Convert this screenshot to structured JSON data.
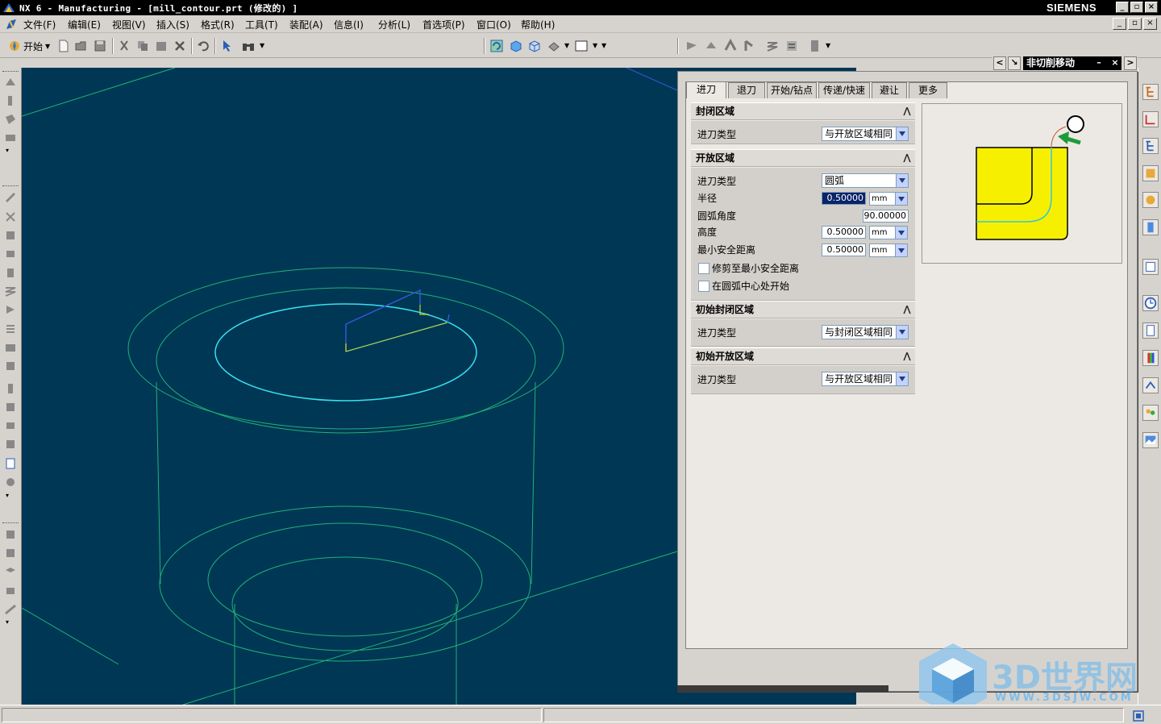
{
  "window": {
    "title": "NX 6 - Manufacturing - [mill_contour.prt  (修改的) ]",
    "brand": "SIEMENS"
  },
  "menu": {
    "items": [
      "文件(F)",
      "编辑(E)",
      "视图(V)",
      "插入(S)",
      "格式(R)",
      "工具(T)",
      "装配(A)",
      "信息(I)",
      "分析(L)",
      "首选项(P)",
      "窗口(O)",
      "帮助(H)"
    ]
  },
  "toolbar": {
    "start_label": "开始"
  },
  "dialog": {
    "title": "非切削移动",
    "tabs": [
      "进刀",
      "退刀",
      "开始/钻点",
      "传递/快速",
      "避让",
      "更多"
    ],
    "active_tab": "进刀",
    "closed_area": {
      "header": "封闭区域",
      "engage_type_label": "进刀类型",
      "engage_type_value": "与开放区域相同"
    },
    "open_area": {
      "header": "开放区域",
      "engage_type_label": "进刀类型",
      "engage_type_value": "圆弧",
      "radius_label": "半径",
      "radius_value": "0.50000",
      "radius_unit": "mm",
      "arc_angle_label": "圆弧角度",
      "arc_angle_value": "90.00000",
      "height_label": "高度",
      "height_value": "0.50000",
      "height_unit": "mm",
      "min_clearance_label": "最小安全距离",
      "min_clearance_value": "0.50000",
      "min_clearance_unit": "mm",
      "trim_label": "修剪至最小安全距离",
      "start_center_label": "在圆弧中心处开始"
    },
    "initial_closed_area": {
      "header": "初始封闭区域",
      "engage_type_label": "进刀类型",
      "engage_type_value": "与封闭区域相同"
    },
    "initial_open_area": {
      "header": "初始开放区域",
      "engage_type_label": "进刀类型",
      "engage_type_value": "与开放区域相同"
    }
  },
  "watermark": {
    "text": "3D世界网",
    "url": "WWW.3DSJW.COM"
  },
  "colors": {
    "viewport_bg": "#003754",
    "wireframe": "#1fb27a",
    "highlight_curve": "#38e0f0",
    "preview_part": "#f6f000",
    "active_selection": "#0a246a"
  }
}
